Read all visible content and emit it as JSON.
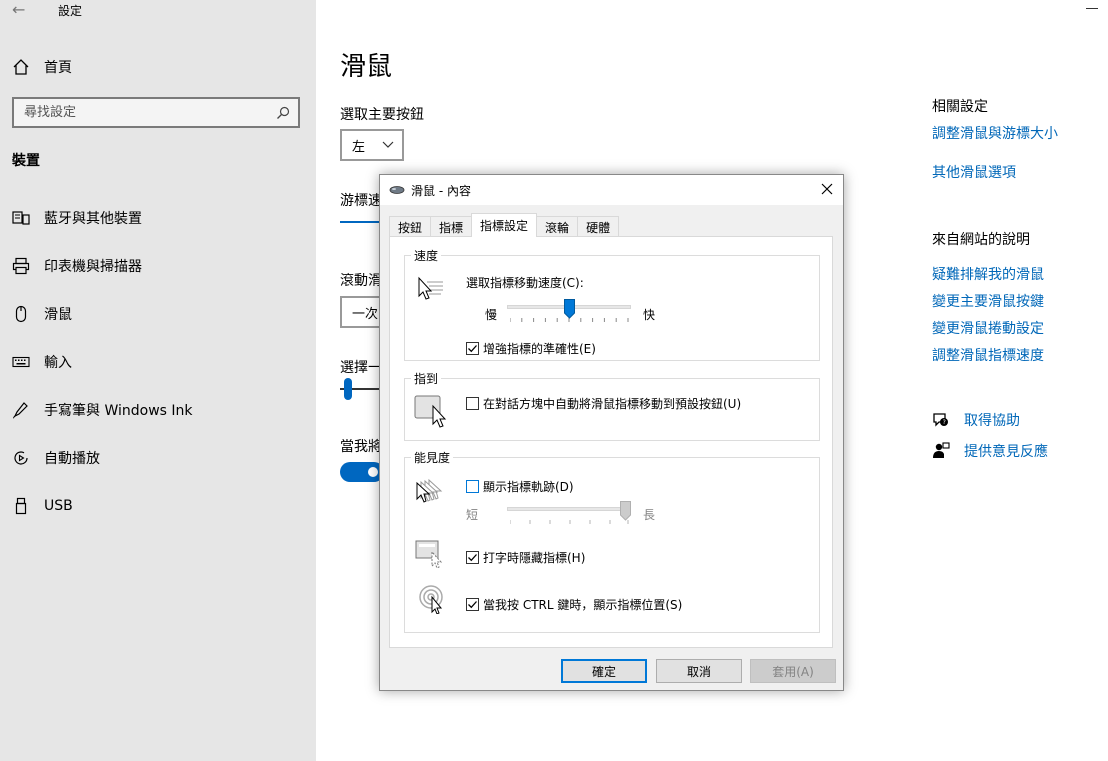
{
  "window": {
    "title": "設定",
    "back_glyph": "←"
  },
  "sidebar": {
    "home_label": "首頁",
    "search_placeholder": "尋找設定",
    "section_heading": "裝置",
    "items": [
      {
        "label": "藍牙與其他裝置",
        "icon": "bluetooth-devices-icon"
      },
      {
        "label": "印表機與掃描器",
        "icon": "printer-icon"
      },
      {
        "label": "滑鼠",
        "icon": "mouse-icon"
      },
      {
        "label": "輸入",
        "icon": "keyboard-icon"
      },
      {
        "label": "手寫筆與 Windows Ink",
        "icon": "pen-icon"
      },
      {
        "label": "自動播放",
        "icon": "autoplay-icon"
      },
      {
        "label": "USB",
        "icon": "usb-icon"
      }
    ]
  },
  "main": {
    "title": "滑鼠",
    "primary_button_label": "選取主要按鈕",
    "primary_button_value": "左",
    "cursor_speed_label": "游標速",
    "scroll_label": "滾動滑",
    "scroll_value": "一次",
    "choose_label": "選擇一",
    "when_label": "當我將"
  },
  "related": {
    "heading": "相關設定",
    "links": [
      "調整滑鼠與游標大小",
      "其他滑鼠選項"
    ]
  },
  "help": {
    "heading": "來自網站的說明",
    "links": [
      "疑難排解我的滑鼠",
      "變更主要滑鼠按鍵",
      "變更滑鼠捲動設定",
      "調整滑鼠指標速度"
    ],
    "get_help": "取得協助",
    "feedback": "提供意見反應"
  },
  "dialog": {
    "title": "滑鼠 - 內容",
    "tabs": [
      "按鈕",
      "指標",
      "指標設定",
      "滾輪",
      "硬體"
    ],
    "active_tab": "指標設定",
    "speed": {
      "group_title": "速度",
      "label": "選取指標移動速度(C):",
      "slow": "慢",
      "fast": "快",
      "value_fraction": 0.5,
      "precision_label": "增強指標的準確性(E)",
      "precision_checked": true
    },
    "snap": {
      "group_title": "指到",
      "label": "在對話方塊中自動將滑鼠指標移動到預設按鈕(U)",
      "checked": false
    },
    "visibility": {
      "group_title": "能見度",
      "trails_label": "顯示指標軌跡(D)",
      "trails_checked": false,
      "short": "短",
      "long": "長",
      "trails_value_fraction": 1.0,
      "hide_label": "打字時隱藏指標(H)",
      "hide_checked": true,
      "ctrl_label": "當我按 CTRL 鍵時，顯示指標位置(S)",
      "ctrl_checked": true
    },
    "buttons": {
      "ok": "確定",
      "cancel": "取消",
      "apply": "套用(A)"
    }
  },
  "colors": {
    "accent": "#0067c0",
    "link": "#0067b8",
    "sidebar_bg": "#e6e6e6"
  }
}
